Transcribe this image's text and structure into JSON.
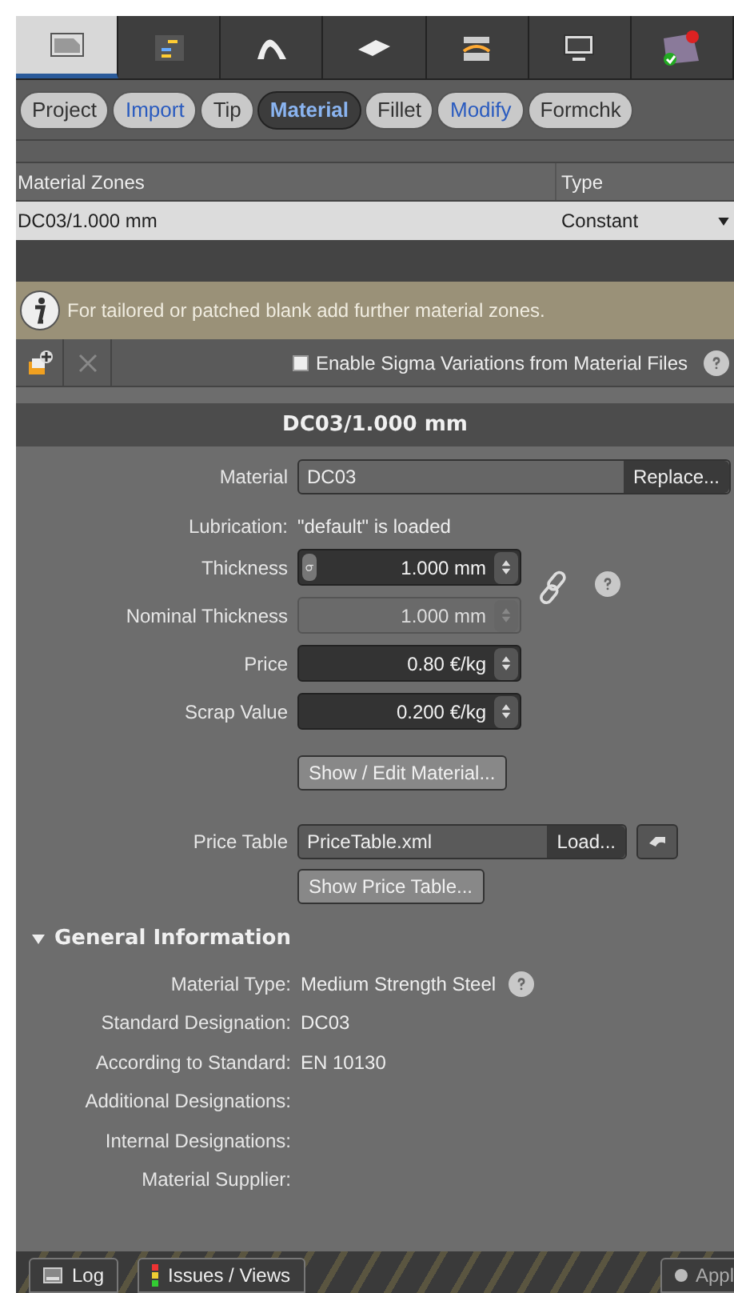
{
  "workflow_steps": [
    {
      "selected": true
    },
    {
      "selected": false
    },
    {
      "selected": false
    },
    {
      "selected": false
    },
    {
      "selected": false
    },
    {
      "selected": false
    },
    {
      "selected": false
    }
  ],
  "tabs": [
    {
      "label": "Project",
      "selected": false,
      "accent": false
    },
    {
      "label": "Import",
      "selected": false,
      "accent": true
    },
    {
      "label": "Tip",
      "selected": false,
      "accent": false
    },
    {
      "label": "Material",
      "selected": true,
      "accent": false
    },
    {
      "label": "Fillet",
      "selected": false,
      "accent": false
    },
    {
      "label": "Modify",
      "selected": false,
      "accent": true
    },
    {
      "label": "Formchk",
      "selected": false,
      "accent": false
    }
  ],
  "table": {
    "columns": [
      "Material Zones",
      "Type"
    ],
    "rows": [
      {
        "zone": "DC03/1.000 mm",
        "type": "Constant",
        "selected": true
      }
    ]
  },
  "info_message": "For tailored or patched blank add further material zones.",
  "sigma_checkbox": {
    "label": "Enable Sigma Variations from Material Files",
    "checked": false
  },
  "section_title": "DC03/1.000 mm",
  "material": {
    "label": "Material",
    "value": "DC03",
    "button": "Replace..."
  },
  "lubrication": {
    "label": "Lubrication:",
    "value": "\"default\" is loaded"
  },
  "fields": [
    {
      "label": "Thickness",
      "value": "1.000 mm",
      "sigma": true,
      "disabled": false
    },
    {
      "label": "Nominal Thickness",
      "value": "1.000 mm",
      "sigma": false,
      "disabled": true
    },
    {
      "label": "Price",
      "value": "0.80 €/kg",
      "sigma": false,
      "disabled": false
    },
    {
      "label": "Scrap Value",
      "value": "0.200 €/kg",
      "sigma": false,
      "disabled": false
    }
  ],
  "edit_material_button": "Show / Edit Material...",
  "price_table": {
    "label": "Price Table",
    "value": "PriceTable.xml",
    "button": "Load..."
  },
  "show_price_table_button": "Show Price Table...",
  "general_information": {
    "title": "General Information",
    "expanded": true,
    "rows": [
      {
        "label": "Material Type:",
        "value": "Medium Strength Steel",
        "help": true
      },
      {
        "label": "Standard Designation:",
        "value": "DC03",
        "help": false
      },
      {
        "label": "According to Standard:",
        "value": "EN 10130",
        "help": false
      },
      {
        "label": "Additional Designations:",
        "value": "",
        "help": false
      },
      {
        "label": "Internal Designations:",
        "value": "",
        "help": false
      },
      {
        "label": "Material Supplier:",
        "value": "",
        "help": false
      }
    ]
  },
  "bottom_bar": {
    "buttons": [
      "Log",
      "Issues / Views"
    ],
    "apply": "Appl"
  }
}
